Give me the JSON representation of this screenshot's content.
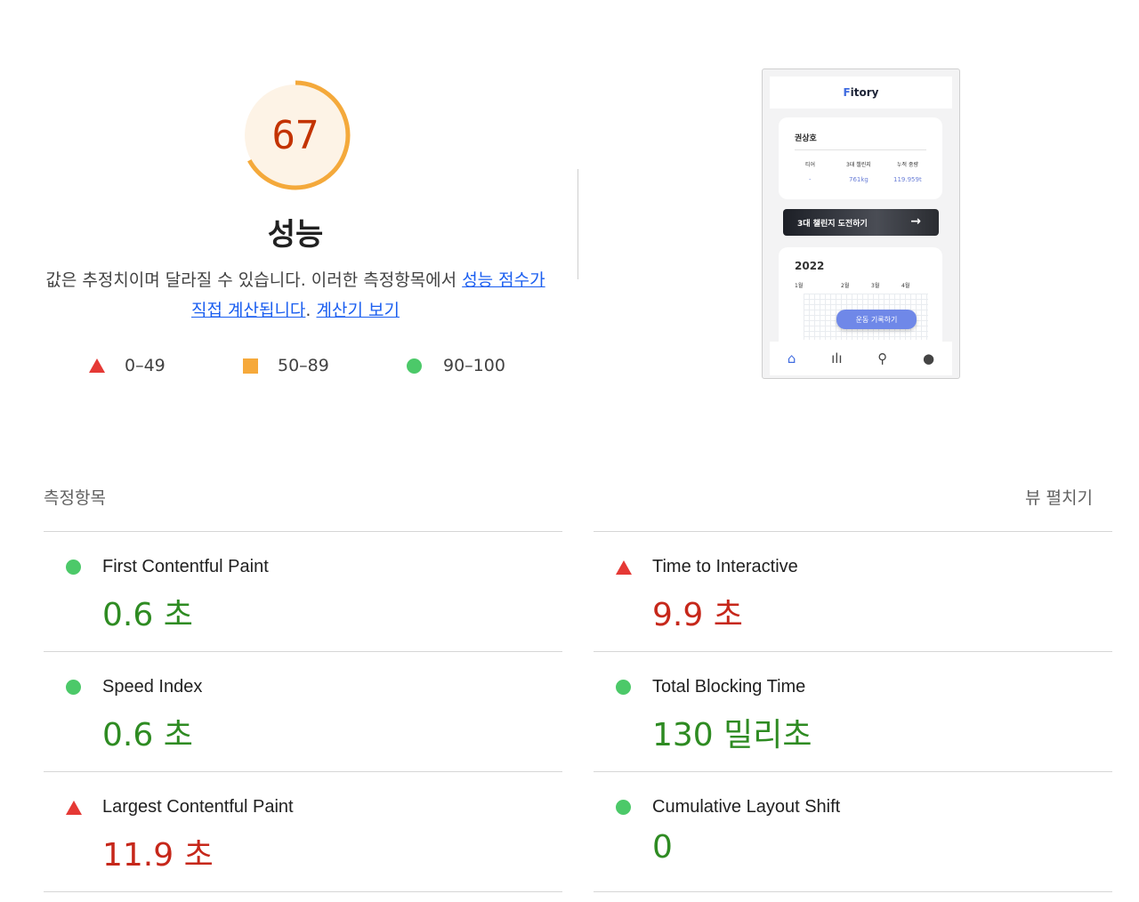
{
  "score": {
    "value": "67",
    "fraction": 0.67,
    "color": "#f4a93b",
    "title": "성능"
  },
  "description": {
    "text_before": "값은 추정치이며 달라질 수 있습니다. 이러한 측정항목에서 ",
    "link1": "성능 점수가 직접 계산됩니다",
    "text_between": ". ",
    "link2": "계산기 보기"
  },
  "legend": [
    {
      "label": "0–49",
      "shape": "triangle",
      "color": "#e53935"
    },
    {
      "label": "50–89",
      "shape": "square",
      "color": "#f6a93b"
    },
    {
      "label": "90–100",
      "shape": "circle",
      "color": "#4cc969"
    }
  ],
  "screenshot": {
    "app_title_accent": "F",
    "app_title_rest": "itory",
    "user_name": "권상호",
    "stats": [
      {
        "label": "티어",
        "value": "-"
      },
      {
        "label": "3대 챌린지",
        "value": "761kg"
      },
      {
        "label": "누적 중량",
        "value": "119.959t"
      }
    ],
    "banner": "3대 챌린지 도전하기",
    "year": "2022",
    "months": [
      "1월",
      "2월",
      "3월",
      "4월"
    ],
    "record_button": "운동 기록하기",
    "nav_icons": [
      "home-icon",
      "chart-icon",
      "search-icon",
      "user-icon"
    ]
  },
  "metrics": {
    "title": "측정항목",
    "toggle": "뷰 펼치기",
    "left": [
      {
        "name": "First Contentful Paint",
        "value": "0.6 초",
        "status": "good"
      },
      {
        "name": "Speed Index",
        "value": "0.6 초",
        "status": "good"
      },
      {
        "name": "Largest Contentful Paint",
        "value": "11.9 초",
        "status": "bad"
      }
    ],
    "right": [
      {
        "name": "Time to Interactive",
        "value": "9.9 초",
        "status": "bad"
      },
      {
        "name": "Total Blocking Time",
        "value": "130 밀리초",
        "status": "good"
      },
      {
        "name": "Cumulative Layout Shift",
        "value": "0",
        "status": "good"
      }
    ]
  }
}
